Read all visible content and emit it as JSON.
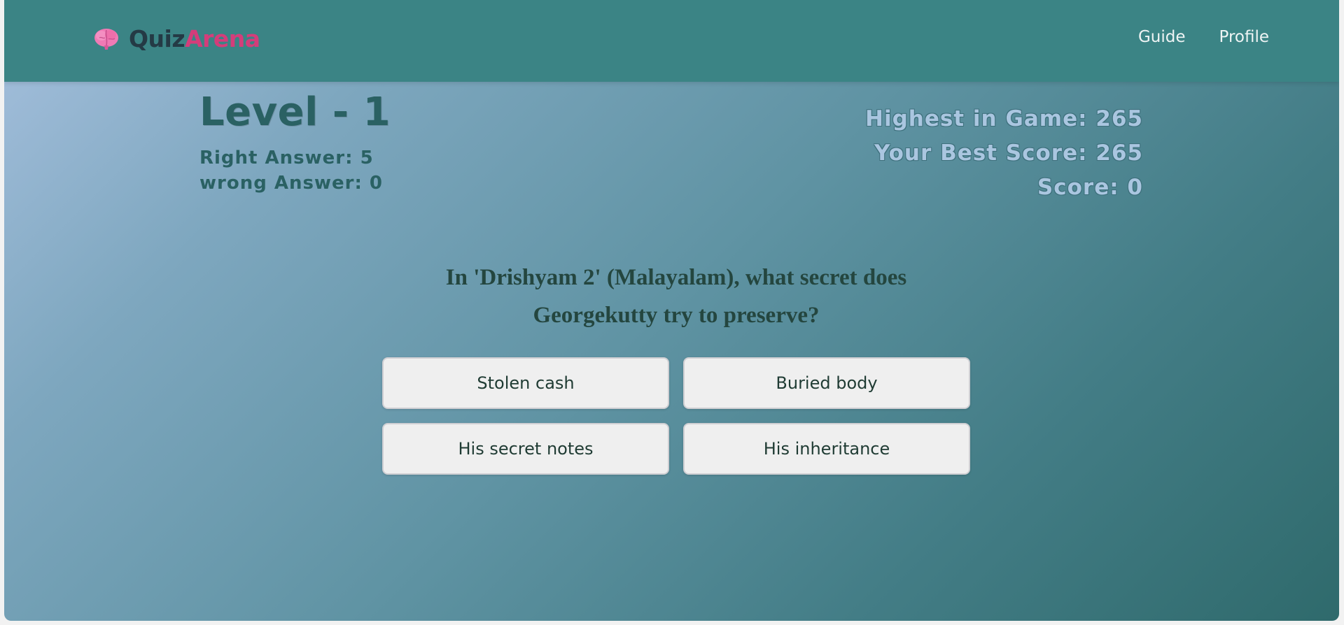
{
  "navbar": {
    "brand_part1": "Quiz",
    "brand_part2": "Arena",
    "brand_icon": "brain-icon",
    "links": [
      "Guide",
      "Profile"
    ]
  },
  "stats": {
    "level": "Level - 1",
    "right_answer": "Right Answer: 5",
    "wrong_answer": "wrong Answer: 0",
    "highest_in_game": "Highest in Game: 265",
    "best_score": "Your Best Score: 265",
    "score": "Score: 0"
  },
  "question": {
    "text": "In 'Drishyam 2' (Malayalam), what secret does Georgekutty try to preserve?"
  },
  "options": [
    "Stolen cash",
    "Buried body",
    "His secret notes",
    "His inheritance"
  ],
  "colors": {
    "navbar": "#3b8485",
    "brand_quiz": "#243a45",
    "brand_arena": "#d43d7a",
    "stats_left": "#2a6163",
    "stats_right": "#aac6e0",
    "question_text": "#24463f",
    "option_bg": "#efefef"
  }
}
